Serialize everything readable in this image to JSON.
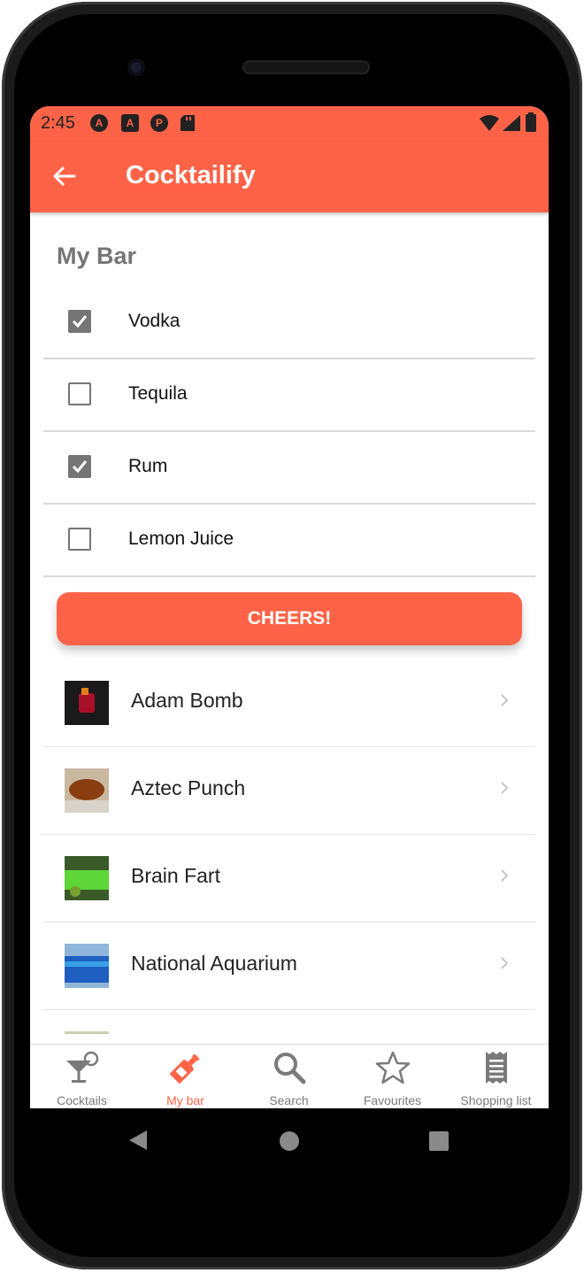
{
  "status_bar": {
    "time": "2:45",
    "indicator_icons": [
      "A",
      "A",
      "P",
      "sd-card"
    ]
  },
  "app_bar": {
    "title": "Cocktailify"
  },
  "section": {
    "title": "My Bar"
  },
  "ingredients": [
    {
      "label": "Vodka",
      "checked": true
    },
    {
      "label": "Tequila",
      "checked": false
    },
    {
      "label": "Rum",
      "checked": true
    },
    {
      "label": "Lemon Juice",
      "checked": false
    }
  ],
  "cheers_button": {
    "label": "CHEERS!"
  },
  "cocktails": [
    {
      "name": "Adam Bomb"
    },
    {
      "name": "Aztec Punch"
    },
    {
      "name": "Brain Fart"
    },
    {
      "name": "National Aquarium"
    }
  ],
  "tabs": [
    {
      "label": "Cocktails",
      "icon": "cocktail-icon",
      "active": false
    },
    {
      "label": "My bar",
      "icon": "bottle-icon",
      "active": true
    },
    {
      "label": "Search",
      "icon": "search-icon",
      "active": false
    },
    {
      "label": "Favourites",
      "icon": "star-icon",
      "active": false
    },
    {
      "label": "Shopping list",
      "icon": "receipt-icon",
      "active": false
    }
  ],
  "colors": {
    "accent": "#ff6347",
    "inactive": "#7a7a7a"
  }
}
